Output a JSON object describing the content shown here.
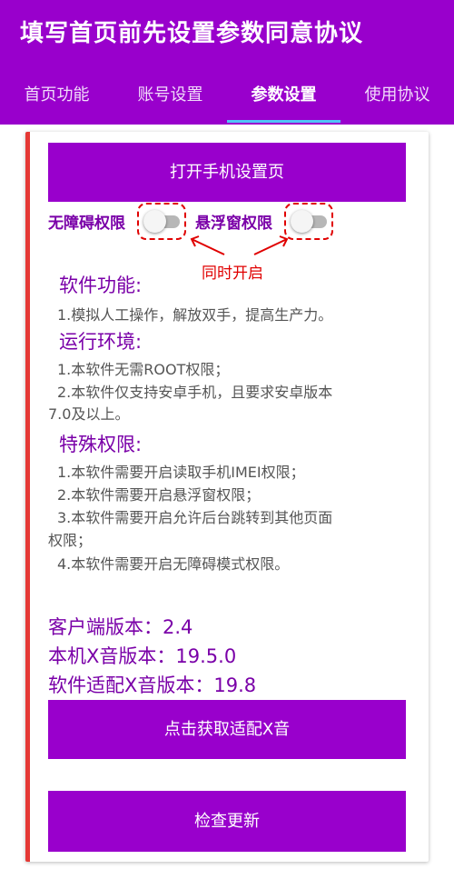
{
  "app": {
    "title": "填写首页前先设置参数同意协议"
  },
  "tabs": [
    {
      "label": "首页功能",
      "active": false
    },
    {
      "label": "账号设置",
      "active": false
    },
    {
      "label": "参数设置",
      "active": true
    },
    {
      "label": "使用协议",
      "active": false
    }
  ],
  "buttons": {
    "open_settings": "打开手机设置页",
    "get_adapted": "点击获取适配X音",
    "check_update": "检查更新"
  },
  "permissions": {
    "accessibility_label": "无障碍权限",
    "accessibility_enabled": false,
    "floating_label": "悬浮窗权限",
    "floating_enabled": false,
    "hint": "同时开启"
  },
  "sections": {
    "features_title": "软件功能:",
    "features_line1": "1.模拟人工操作，解放双手，提高生产力。",
    "env_title": "运行环境:",
    "env_line1": "1.本软件无需ROOT权限；",
    "env_line2a": "2.本软件仅支持安卓手机，且要求安卓版本",
    "env_line2b": "7.0及以上。",
    "perm_title": "特殊权限:",
    "perm_line1": "1.本软件需要开启读取手机IMEI权限；",
    "perm_line2": "2.本软件需要开启悬浮窗权限；",
    "perm_line3a": "3.本软件需要开启允许后台跳转到其他页面",
    "perm_line3b": "权限；",
    "perm_line4": "4.本软件需要开启无障碍模式权限。"
  },
  "versions": {
    "client": "客户端版本：2.4",
    "local_x": "本机X音版本：19.5.0",
    "adapted_x": "软件适配X音版本：19.8"
  },
  "colors": {
    "primary": "#9900cc",
    "accent_text": "#7a00a8",
    "indicator": "#4fc3f7",
    "warning": "#e00000"
  }
}
